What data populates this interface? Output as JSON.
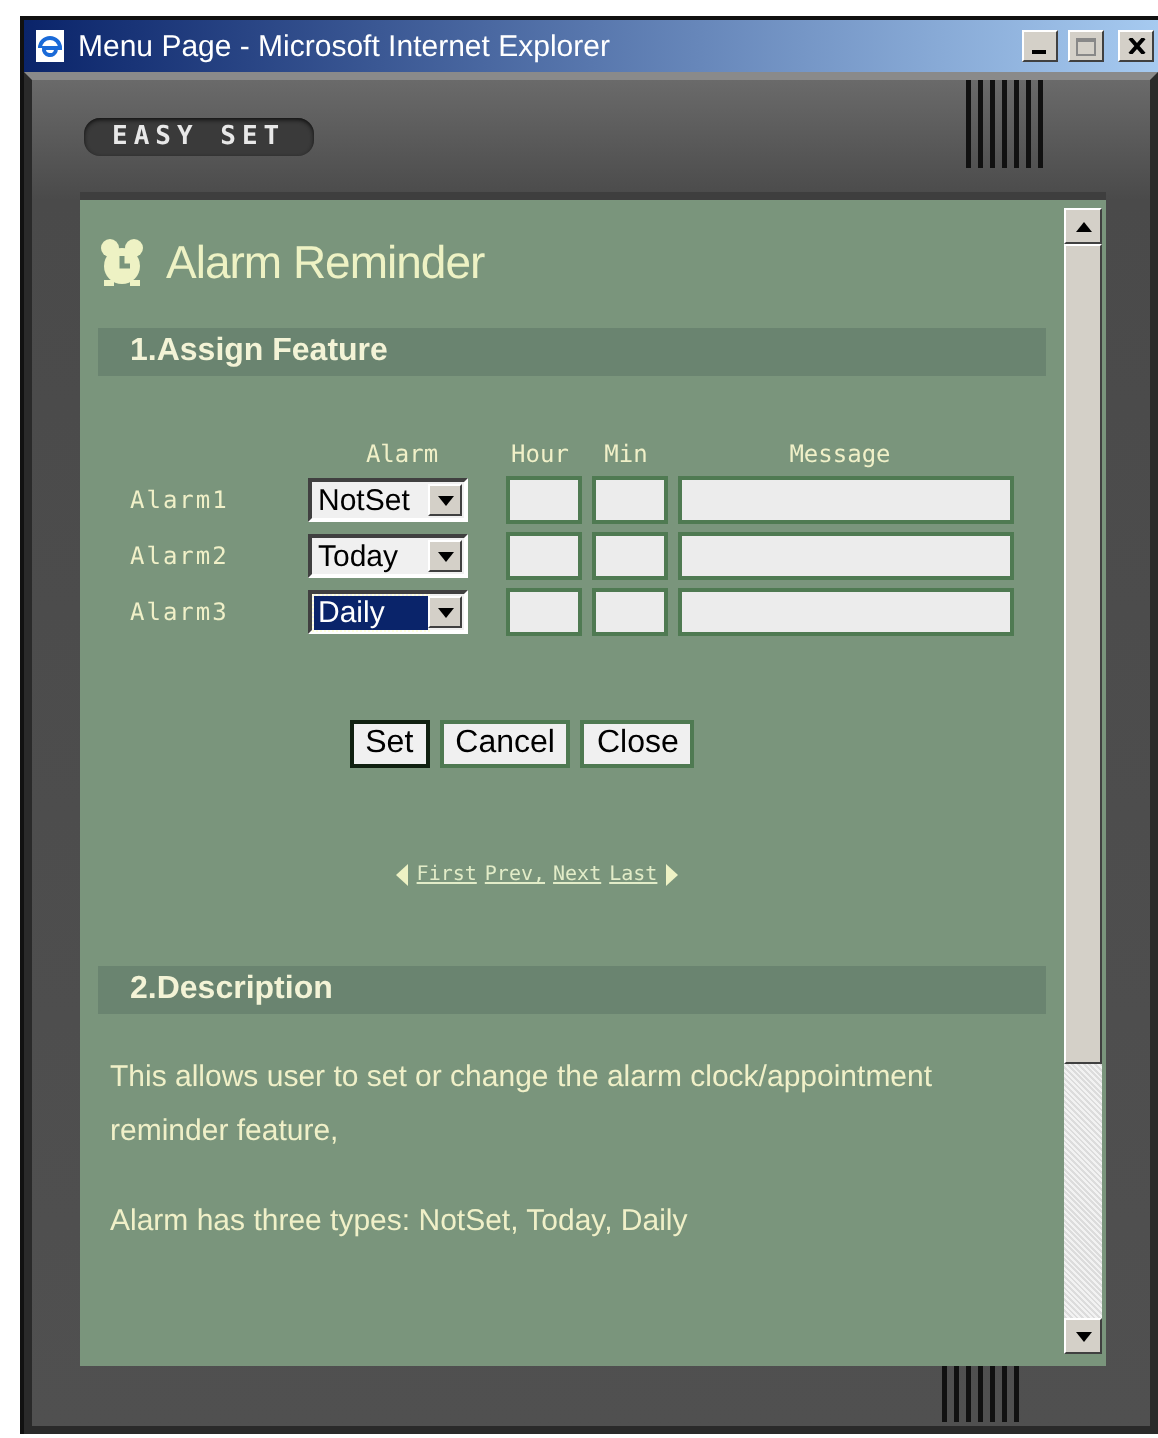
{
  "window": {
    "title": "Menu Page - Microsoft Internet Explorer"
  },
  "frame": {
    "label": "EASY SET"
  },
  "page": {
    "title": "Alarm Reminder"
  },
  "assign": {
    "heading": "1.Assign Feature",
    "columns": [
      "Alarm",
      "Hour",
      "Min",
      "Message"
    ],
    "rows": [
      {
        "label": "Alarm1",
        "alarm": "NotSet",
        "focused": false
      },
      {
        "label": "Alarm2",
        "alarm": "Today",
        "focused": false
      },
      {
        "label": "Alarm3",
        "alarm": "Daily",
        "focused": true
      }
    ],
    "buttons": [
      {
        "label": "Set",
        "focused": true
      },
      {
        "label": "Cancel",
        "focused": false
      },
      {
        "label": "Close",
        "focused": false
      }
    ],
    "nav": [
      "First",
      "Prev,",
      "Next",
      "Last"
    ]
  },
  "description": {
    "heading": "2.Description",
    "paragraphs": [
      "This allows user to set or change the alarm clock/appointment reminder feature,",
      "Alarm has three types: NotSet, Today, Daily"
    ]
  }
}
